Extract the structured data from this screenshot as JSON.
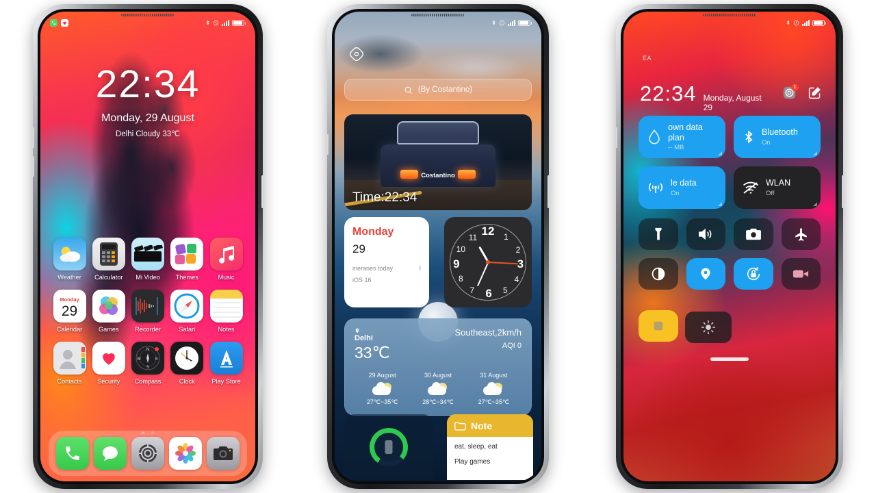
{
  "phone1": {
    "status": {
      "left_icons": [
        "phone-mini-icon",
        "health-mini-icon"
      ],
      "bluetooth": "bluetooth-icon",
      "alarm": "alarm-icon",
      "signal_label": "signal-bars",
      "battery_label": "battery-full-icon"
    },
    "lockscreen": {
      "time": "22:34",
      "date": "Monday, 29 August",
      "weather": "Delhi  Cloudy  33℃"
    },
    "apps_row1": [
      {
        "name": "Weather",
        "icon": "weather-icon"
      },
      {
        "name": "Calculator",
        "icon": "calculator-icon"
      },
      {
        "name": "Mi Video",
        "icon": "mi-video-icon"
      },
      {
        "name": "Themes",
        "icon": "themes-icon"
      },
      {
        "name": "Music",
        "icon": "music-icon"
      }
    ],
    "apps_row2": [
      {
        "name": "Calendar",
        "icon": "calendar-icon",
        "cal_day": "Monday",
        "cal_num": "29"
      },
      {
        "name": "Games",
        "icon": "games-icon"
      },
      {
        "name": "Recorder",
        "icon": "recorder-icon"
      },
      {
        "name": "Safari",
        "icon": "safari-icon"
      },
      {
        "name": "Notes",
        "icon": "notes-icon"
      }
    ],
    "apps_row3": [
      {
        "name": "Contacts",
        "icon": "contacts-icon"
      },
      {
        "name": "Security",
        "icon": "security-icon"
      },
      {
        "name": "Compass",
        "icon": "compass-icon"
      },
      {
        "name": "Clock",
        "icon": "clock-icon"
      },
      {
        "name": "Play Store",
        "icon": "play-store-icon"
      }
    ],
    "dock": [
      {
        "name": "Phone",
        "icon": "phone-icon"
      },
      {
        "name": "Messages",
        "icon": "messages-icon"
      },
      {
        "name": "Settings",
        "icon": "settings-icon"
      },
      {
        "name": "Photos",
        "icon": "photos-icon"
      },
      {
        "name": "Camera",
        "icon": "camera-icon"
      }
    ],
    "page_dots": 2,
    "active_dot": 0
  },
  "phone2": {
    "assistant_icon": "assistant-diamond-icon",
    "search": {
      "placeholder": "(By Costantino)",
      "icon": "search-icon"
    },
    "media_widget": {
      "badge": "Costantino",
      "time_label": "Time:22:34"
    },
    "calendar_widget": {
      "day": "Monday",
      "date": "29",
      "line1": "ineraries today",
      "line1_right": "I",
      "line2": "iOS 16"
    },
    "clock_widget": {
      "numbers": [
        "12",
        "1",
        "2",
        "3",
        "4",
        "5",
        "6",
        "7",
        "8",
        "9",
        "10",
        "11"
      ],
      "time": "22:34"
    },
    "weather_widget": {
      "city": "Delhi",
      "temp": "33℃",
      "wind": "Southeast,2km/h",
      "aqi": "AQI  0",
      "forecast": [
        {
          "date": "29 August",
          "range": "27℃~35℃",
          "icon": "partly-cloudy-icon"
        },
        {
          "date": "30 August",
          "range": "28℃~34℃",
          "icon": "partly-cloudy-icon"
        },
        {
          "date": "31 August",
          "range": "27℃~35℃",
          "icon": "partly-cloudy-icon"
        }
      ]
    },
    "battery_widget": {
      "icon": "battery-ring-icon",
      "percent": 78
    },
    "note_widget": {
      "title": "Note",
      "icon": "folder-icon",
      "lines": [
        "eat, sleep, eat",
        "Play games"
      ]
    }
  },
  "phone3": {
    "carrier": "EA",
    "time": "22:34",
    "date": "Monday, August 29",
    "header_icons": [
      "notifications-badge-icon",
      "edit-icon"
    ],
    "notification_count": "1",
    "big_tiles": [
      {
        "title": "own data plan",
        "sub": "-- MB",
        "icon": "data-drop-icon",
        "state": "on"
      },
      {
        "title": "Bluetooth",
        "sub": "On",
        "icon": "bluetooth-icon",
        "state": "on"
      },
      {
        "title": "le data",
        "sub": "On",
        "icon": "mobile-data-icon",
        "state": "on"
      },
      {
        "title": "WLAN",
        "sub": "Off",
        "icon": "wifi-off-icon",
        "state": "off"
      }
    ],
    "toggles": [
      {
        "name": "Flashlight",
        "icon": "flashlight-icon",
        "state": "off"
      },
      {
        "name": "Volume",
        "icon": "speaker-icon",
        "state": "off"
      },
      {
        "name": "Camera",
        "icon": "camera-icon",
        "state": "off"
      },
      {
        "name": "Airplane mode",
        "icon": "airplane-icon",
        "state": "off"
      },
      {
        "name": "Dark mode",
        "icon": "contrast-icon",
        "state": "off"
      },
      {
        "name": "Location",
        "icon": "location-pin-icon",
        "state": "on"
      },
      {
        "name": "Auto rotate lock",
        "icon": "rotation-lock-icon",
        "state": "on"
      },
      {
        "name": "Screen recorder",
        "icon": "video-camera-icon",
        "state": "off"
      },
      {
        "name": "Screenshot",
        "icon": "screenshot-icon",
        "state": "yellow"
      }
    ],
    "brightness": {
      "icon": "brightness-icon"
    },
    "home_indicator": "home-indicator"
  },
  "colors": {
    "accent_blue": "#1da1f0",
    "tile_off": "#232325",
    "yellow": "#f9c224",
    "note_header": "#e8b72e",
    "calendar_red": "#e8443a",
    "ring_green": "#2fc94f"
  }
}
